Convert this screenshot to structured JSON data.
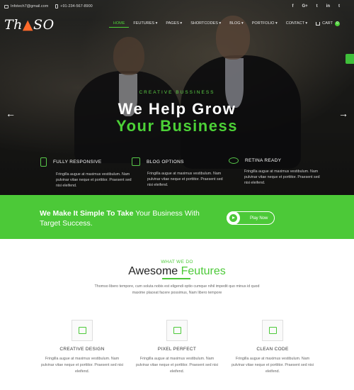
{
  "topbar": {
    "email": "Infotech7@gmail.com",
    "phone": "+91-234-567-8900",
    "socials": [
      "f",
      "G+",
      "t",
      "in",
      "t"
    ]
  },
  "logo": {
    "prefix": "Th",
    "accent": "▲",
    "suffix": "SO"
  },
  "nav": {
    "items": [
      "HOME",
      "FEUTURES ▾",
      "PAGES ▾",
      "SHORTCODES ▾",
      "BLOG ▾",
      "PORTFOLIO ▾",
      "CONTACT ▾"
    ],
    "cart_label": "Cart",
    "cart_count": "0"
  },
  "hero": {
    "subtitle": "CREATIVE BUSSINESS",
    "title_line1": "We Help Grow",
    "title_line2": "Your Business",
    "arrow_left": "←",
    "arrow_right": "→",
    "features": [
      {
        "icon": "mobile-icon",
        "title": "FULLY RESPONSIVE",
        "text": "Fringilla augue at maximus vestibulum. Nam pulvinar vitae neque et porttitor. Praesent sed nisi eleifend."
      },
      {
        "icon": "grid-icon",
        "title": "BLOG OPTIONS",
        "text": "Fringilla augue at maximus vestibulum. Nam pulvinar vitae neque et porttitor. Praesent sed nisi eleifend."
      },
      {
        "icon": "eye-icon",
        "title": "RETINA READY",
        "text": "Fringilla augue at maximus vestibulum. Nam pulvinar vitae neque et porttitor. Praesent sed nisi eleifend."
      }
    ]
  },
  "cta": {
    "bold": "We Make It Simple To Take",
    "rest": " Your Business With Target Success.",
    "play_label": "Play Now"
  },
  "features_section": {
    "kicker": "WHAT WE DO",
    "title_dark": "Awesome ",
    "title_green": "Feutures",
    "intro": "Thomso libero tempore, cum soluta nobis est eligendi optio cumque nihil impedit quo minus id quod maxime placeat facere possimus, Nam libero tempore",
    "items": [
      {
        "icon": "image-icon",
        "title": "CREATIVE DESIGN",
        "text": "Fringilla augue at maximus vestibulum. Nam pulvinar vitae neque et porttitor. Praesent sed nisi eleifend."
      },
      {
        "icon": "image-icon",
        "title": "PIXEL PERFECT",
        "text": "Fringilla augue at maximus vestibulum. Nam pulvinar vitae neque et porttitor. Praesent sed nisi eleifend."
      },
      {
        "icon": "code-icon",
        "title": "CLEAN CODE",
        "text": "Fringilla augue at maximus vestibulum. Nam pulvinar vitae neque et porttitor. Praesent sed nisi eleifend."
      }
    ]
  },
  "colors": {
    "accent": "#4cc938",
    "logo_accent": "#ff6a2b",
    "hero_dark": "#262623"
  }
}
